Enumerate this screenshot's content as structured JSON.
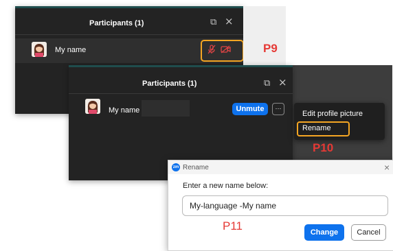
{
  "panel1": {
    "title": "Participants (1)",
    "participant_name": "My name",
    "callout": "P9"
  },
  "panel2": {
    "title": "Participants (1)",
    "participant_name": "My name",
    "unmute_label": "Unmute",
    "more_label": "···",
    "menu": {
      "edit_profile": "Edit profile picture",
      "rename": "Rename"
    },
    "callout": "P10"
  },
  "rename_dialog": {
    "app_icon": "zm",
    "title": "Rename",
    "close": "×",
    "prompt": "Enter a new name below:",
    "input_value": "My-language -My name",
    "callout": "P11",
    "change_label": "Change",
    "cancel_label": "Cancel"
  },
  "colors": {
    "panel_bg": "#232323",
    "accent_blue": "#0e72ed",
    "highlight_orange": "#f5a623",
    "callout_red": "#e53935",
    "muted_red": "#e04444"
  },
  "icons": {
    "popout": "popout-icon",
    "close": "close-icon",
    "mic_muted": "mic-muted-icon",
    "video_off": "video-off-icon",
    "avatar": "avatar-icon"
  }
}
